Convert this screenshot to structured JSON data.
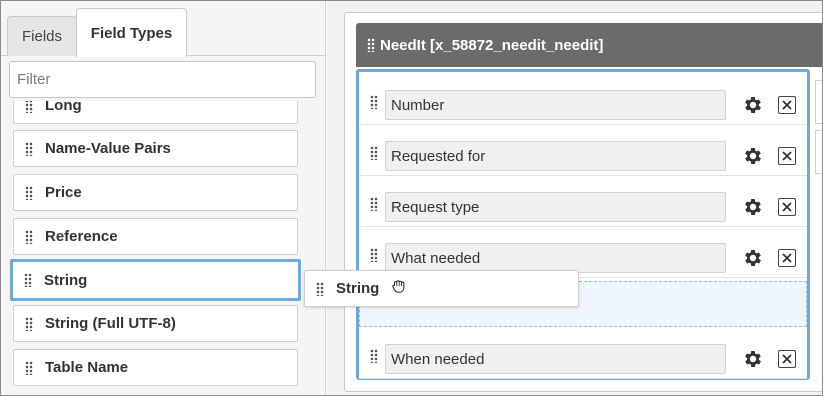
{
  "tabs": [
    {
      "label": "Fields"
    },
    {
      "label": "Field Types"
    }
  ],
  "filter": {
    "placeholder": "Filter",
    "value": ""
  },
  "field_types": [
    {
      "label": "Long"
    },
    {
      "label": "Name-Value Pairs"
    },
    {
      "label": "Price"
    },
    {
      "label": "Reference"
    },
    {
      "label": "String"
    },
    {
      "label": "String (Full UTF-8)"
    },
    {
      "label": "Table Name"
    }
  ],
  "section": {
    "title": "NeedIt [x_58872_needit_needit]"
  },
  "form_fields": [
    {
      "label": "Number"
    },
    {
      "label": "Requested for"
    },
    {
      "label": "Request type"
    },
    {
      "label": "What needed"
    },
    {
      "label": "When needed"
    }
  ],
  "drag_item": {
    "label": "String"
  },
  "icons": {
    "drag_handle": "drag-handle-icon",
    "gear": "gear-icon",
    "close": "close-icon",
    "cursor": "grab-hand-cursor-icon"
  },
  "colors": {
    "accent": "#6fa8dc",
    "header_bg": "#6b6b6b",
    "panel_bg": "#f5f5f5"
  }
}
